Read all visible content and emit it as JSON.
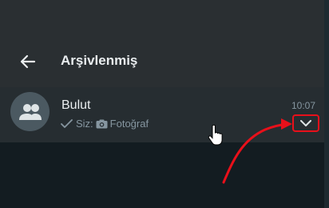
{
  "header": {
    "back_icon": "arrow-left-icon",
    "title": "Arşivlenmiş"
  },
  "chat": {
    "name": "Bulut",
    "time": "10:07",
    "preview_icons": [
      "double-check-icon",
      "camera-icon"
    ],
    "preview_sender": "Siz:",
    "preview_text": "Fotoğraf",
    "avatar_icon": "group-icon",
    "dropdown_icon": "chevron-down-icon"
  },
  "annotation": {
    "highlight_color": "#e8101a",
    "arrow_color": "#e8101a"
  },
  "colors": {
    "header_bg": "#2a2f32",
    "chat_bg": "#262d31",
    "page_bg": "#131c21",
    "primary_text": "#e9edef",
    "secondary_text": "#8696a0"
  }
}
